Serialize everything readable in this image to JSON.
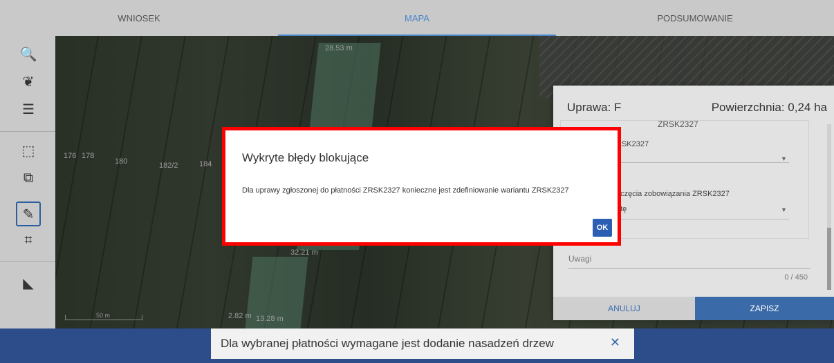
{
  "tabs": [
    {
      "label": "WNIOSEK",
      "active": false
    },
    {
      "label": "MAPA",
      "active": true
    },
    {
      "label": "PODSUMOWANIE",
      "active": false
    }
  ],
  "toolbar": {
    "tools": [
      {
        "name": "search",
        "glyph": "🔍"
      },
      {
        "name": "crop",
        "glyph": "❦"
      },
      {
        "name": "list",
        "glyph": "☰"
      },
      {
        "name": "select-area",
        "glyph": "⬚"
      },
      {
        "name": "copy",
        "glyph": "⧉"
      },
      {
        "name": "edit",
        "glyph": "✎"
      },
      {
        "name": "bounding-box",
        "glyph": "⌗"
      },
      {
        "name": "measure",
        "glyph": "◣"
      }
    ]
  },
  "map": {
    "labels": [
      "176",
      "178",
      "180",
      "182/2",
      "184",
      "28.53 m",
      "32.21 m",
      "2.82 m",
      "13.28 m"
    ],
    "scale": "50 m"
  },
  "panel": {
    "uprawa": "Uprawa: F",
    "powierzchnia": "Powierzchnia: 0,24 ha",
    "cut_text": "ZRSK2327",
    "field1_label": "RSK2327",
    "field2_label": "oczęcia zobowiązania ZRSK2327",
    "field2_value": "atę",
    "uwagi_label": "Uwagi",
    "counter": "0 / 450",
    "cancel": "ANULUJ",
    "save": "ZAPISZ"
  },
  "modal": {
    "title": "Wykryte błędy blokujące",
    "body": "Dla uprawy zgłoszonej do płatności ZRSK2327 konieczne jest zdefiniowanie wariantu ZRSK2327",
    "ok": "OK"
  },
  "toast": {
    "message": "Dla wybranej płatności wymagane jest dodanie nasadzeń drzew",
    "close": "✕"
  }
}
